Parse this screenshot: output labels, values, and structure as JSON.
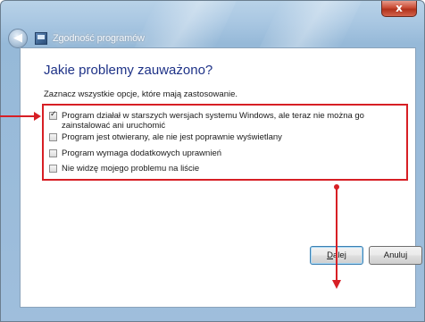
{
  "window": {
    "title": "Zgodność programów",
    "close_glyph": "x"
  },
  "page": {
    "heading": "Jakie problemy zauważono?",
    "instruction": "Zaznacz wszystkie opcje, które mają zastosowanie."
  },
  "options": [
    {
      "label": "Program działał w starszych wersjach systemu Windows, ale teraz nie można go zainstalować ani uruchomić",
      "checked": true
    },
    {
      "label": "Program jest otwierany, ale nie jest poprawnie wyświetlany",
      "checked": false
    },
    {
      "label": "Program wymaga dodatkowych uprawnień",
      "checked": false
    },
    {
      "label": "Nie widzę mojego problemu na liście",
      "checked": false
    }
  ],
  "buttons": {
    "next_ul": "D",
    "next_rest": "alej",
    "cancel": "Anuluj"
  },
  "colors": {
    "annotation": "#d71f25",
    "heading": "#1e3287"
  }
}
